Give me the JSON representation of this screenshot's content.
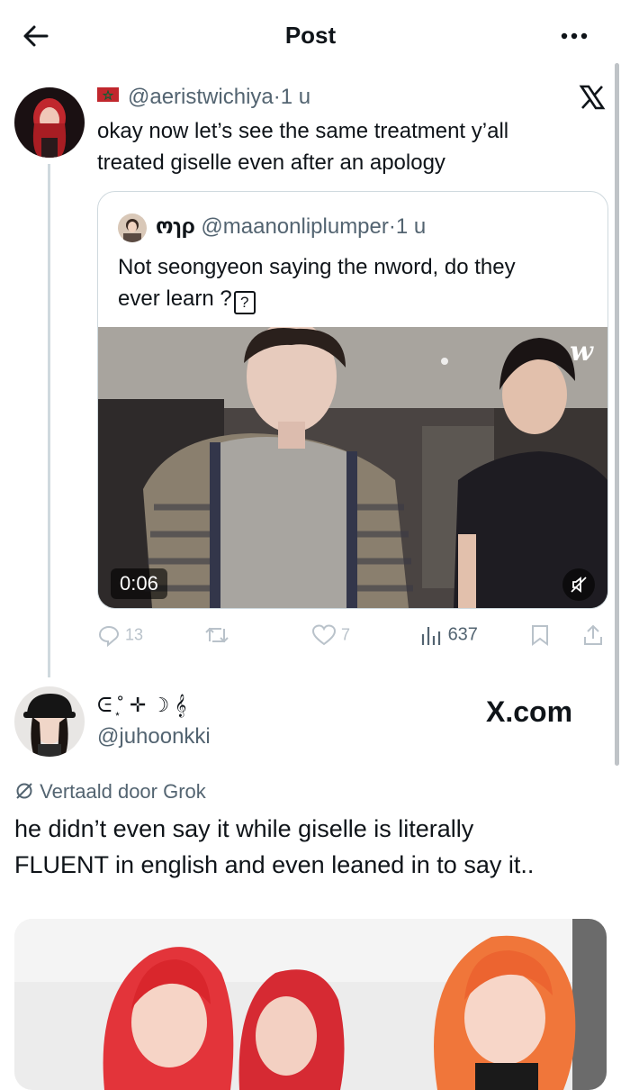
{
  "header": {
    "title": "Post",
    "back_icon": "arrow-left-icon",
    "more_icon": "more-horizontal-icon"
  },
  "post": {
    "flag": "🇲🇦",
    "handle": "@aeristwichiya",
    "separator": "·",
    "time": "1 u",
    "text_line1": "okay now let’s see the same treatment y’all",
    "text_line2": "treated giselle even after an apology",
    "watermark": "X",
    "quote": {
      "display_name": "ოɿρ",
      "handle": "@maanonliplumper",
      "separator": "·",
      "time": "1 u",
      "text_line1": "Not seongyeon saying the nword, do they",
      "text_line2": "ever learn ?",
      "unknown_glyph": "?",
      "video_time": "0:06",
      "video_logo": "w"
    },
    "actions": {
      "replies": "13",
      "reposts": "",
      "likes": "7",
      "views": "637"
    }
  },
  "reply": {
    "display_name": "ᕮ ͙˚ ✛ ☽ 𝄞",
    "handle": "@juhoonkki",
    "watermark": "X.com",
    "translated_label": "Vertaald door Grok",
    "text_line1": "he didn’t even say it while giselle is literally",
    "text_line2": "FLUENT in english and even leaned in to say it.."
  },
  "colors": {
    "text": "#0f1419",
    "secondary": "#536471",
    "border": "#cfd9de",
    "actions": "#b9c2ca"
  }
}
